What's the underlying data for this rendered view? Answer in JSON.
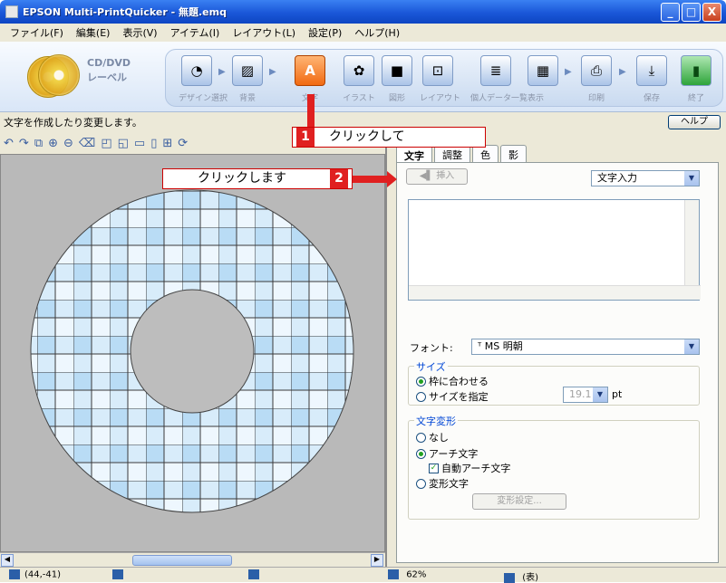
{
  "window": {
    "title": "EPSON Multi-PrintQuicker - 無題.emq",
    "minimize_label": "_",
    "maximize_label": "□",
    "close_label": "X"
  },
  "menu": [
    "ファイル(F)",
    "編集(E)",
    "表示(V)",
    "アイテム(I)",
    "レイアウト(L)",
    "設定(P)",
    "ヘルプ(H)"
  ],
  "toolbar": {
    "brand_line1": "CD/DVD",
    "brand_line2": "レーベル",
    "tools": [
      {
        "label": "デザイン選択",
        "icon": "design-select-icon",
        "glyph": "◔"
      },
      {
        "label": "背景",
        "icon": "background-icon",
        "glyph": "▨"
      },
      {
        "label": "文字",
        "icon": "text-icon",
        "glyph": "A",
        "active": true
      },
      {
        "label": "イラスト",
        "icon": "illustration-icon",
        "glyph": "✿"
      },
      {
        "label": "図形",
        "icon": "shape-icon",
        "glyph": "■"
      },
      {
        "label": "レイアウト",
        "icon": "layout-icon",
        "glyph": "⊡"
      },
      {
        "label": "個人データ一覧表示",
        "icon": "data-list-icon",
        "glyph": "≣"
      },
      {
        "label": "",
        "icon": "grid-icon",
        "glyph": "▦"
      },
      {
        "label": "印刷",
        "icon": "print-icon",
        "glyph": "⎙"
      },
      {
        "label": "保存",
        "icon": "save-icon",
        "glyph": "⤓"
      },
      {
        "label": "終了",
        "icon": "exit-icon",
        "glyph": "▮"
      }
    ]
  },
  "info": {
    "status_text": "文字を作成したり変更します。",
    "help_label": "ヘルプ"
  },
  "panel": {
    "tabs": [
      "文字",
      "調整",
      "色",
      "影"
    ],
    "insert_label": "挿入",
    "mode_select": "文字入力",
    "font_label": "フォント:",
    "font_value": "MS 明朝",
    "size_group": "サイズ",
    "size_fit": "枠に合わせる",
    "size_specify": "サイズを指定",
    "size_value": "19.1",
    "size_unit": "pt",
    "deform_group": "文字変形",
    "deform_none": "なし",
    "deform_arch": "アーチ文字",
    "deform_auto_arch": "自動アーチ文字",
    "deform_shape": "変形文字",
    "deform_settings": "変形設定..."
  },
  "status": {
    "coords": "(44,-41)",
    "zoom": "62%",
    "page": "(表)"
  },
  "callouts": {
    "step1_num": "1",
    "step1_text": "クリックして",
    "step2_num": "2",
    "step2_text": "クリックします"
  }
}
